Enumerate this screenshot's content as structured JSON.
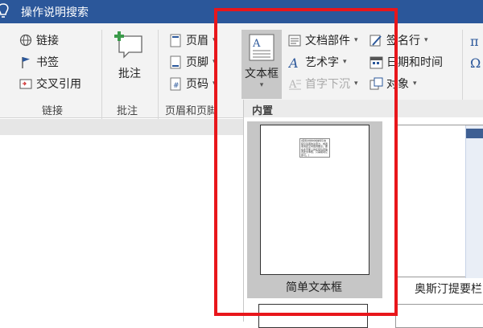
{
  "titlebar": {
    "tell_me": "操作说明搜索"
  },
  "ribbon": {
    "links": {
      "items": [
        "链接",
        "书签",
        "交叉引用"
      ],
      "label": "链接"
    },
    "comments": {
      "button": "批注",
      "label": "批注"
    },
    "header_footer": {
      "items": [
        "页眉",
        "页脚",
        "页码"
      ],
      "label": "页眉和页脚"
    },
    "text": {
      "textbox": "文本框",
      "items": [
        "文档部件",
        "艺术字",
        "首字下沉",
        "签名行",
        "日期和时间",
        "对象"
      ]
    }
  },
  "gallery": {
    "section": "内置",
    "tiles": [
      "简单文本框",
      "奥斯汀提要栏"
    ],
    "sample_text": "[使用文档中的独特引言吸引读者的注意力，或者使用此空间强调要点。要在此页面上的任何位置放置此文本框，只需拖动它即可。]"
  },
  "colors": {
    "title_bar": "#2b579a",
    "highlight": "#e8161b",
    "accent": "#2b579a"
  }
}
